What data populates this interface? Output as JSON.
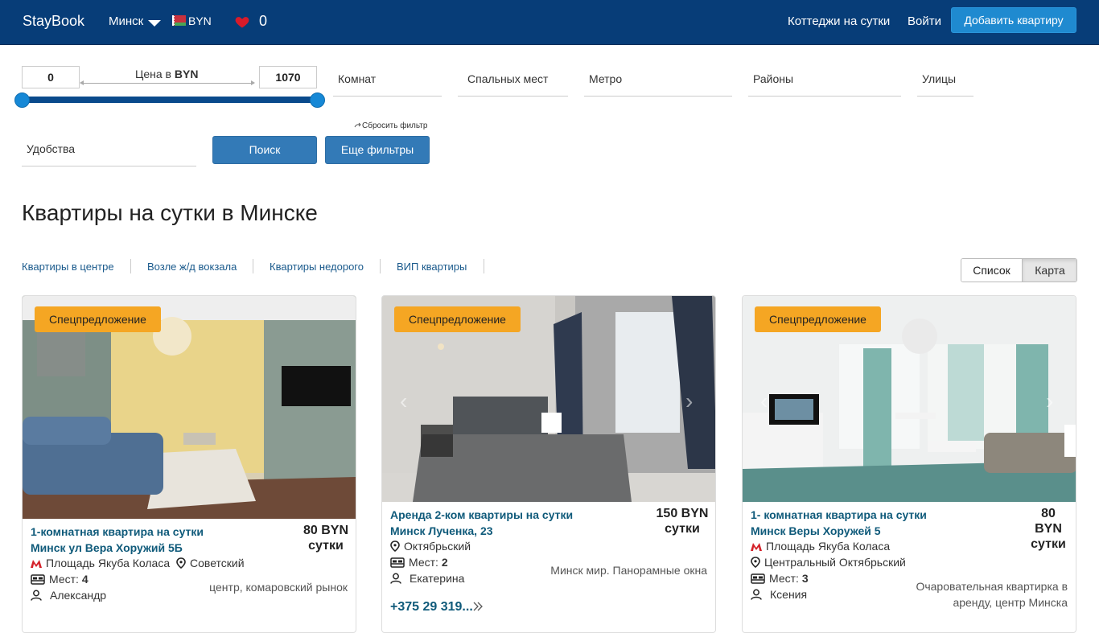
{
  "navbar": {
    "brand": "StayBook",
    "city": "Минск",
    "currency": "BYN",
    "favorites_count": "0",
    "links": {
      "cottages": "Коттеджи на сутки",
      "login": "Войти",
      "add": "Добавить квартиру"
    },
    "colors": {
      "background": "#073d78",
      "add_button": "#1f8ad0"
    }
  },
  "filters": {
    "price": {
      "min": "0",
      "max": "1070",
      "label_prefix": "Цена в",
      "label_currency": "BYN"
    },
    "dropdowns": {
      "rooms": "Комнат",
      "beds": "Спальных мест",
      "metro": "Метро",
      "districts": "Районы",
      "streets": "Улицы",
      "amenities": "Удобства"
    },
    "reset": "Сбросить фильтр",
    "search_button": "Поиск",
    "more_filters_button": "Еще фильтры"
  },
  "page_title": "Квартиры на сутки в Минске",
  "quick_links": [
    "Квартиры в центре",
    "Возле ж/д вокзала",
    "Квартиры недорого",
    "ВИП квартиры"
  ],
  "view_toggle": {
    "list": "Список",
    "map": "Карта"
  },
  "listings": [
    {
      "badge": "Спецпредложение",
      "title_line1": "1-комнатная квартира на сутки",
      "title_line2": "Минск ул Вера Хоружий 5Б",
      "price_amount": "80 BYN",
      "price_unit": "сутки",
      "metro": "Площадь Якуба Коласа",
      "district": "Советский",
      "places_label": "Мест:",
      "places": "4",
      "host": "Александр",
      "description": "центр, комаровский рынок"
    },
    {
      "badge": "Спецпредложение",
      "title_line1": "Аренда 2-ком квартиры на сутки",
      "title_line2": "Минск Лученка, 23",
      "price_amount": "150 BYN",
      "price_unit": "сутки",
      "district": "Октябрьский",
      "places_label": "Мест:",
      "places": "2",
      "host": "Екатерина",
      "description": "Минск мир. Панорамные окна",
      "phone": "+375 29 319..."
    },
    {
      "badge": "Спецпредложение",
      "title_line1": "1- комнатная квартира на сутки",
      "title_line2": "Минск Веры Хоружей 5",
      "price_line1": "80",
      "price_line2": "BYN",
      "price_unit": "сутки",
      "metro": "Площадь Якуба Коласа",
      "district": "Центральный Октябрьский",
      "places_label": "Мест:",
      "places": "3",
      "host": "Ксения",
      "description_line1": "Очаровательная квартирка в",
      "description_line2": "аренду, центр Минска"
    }
  ]
}
